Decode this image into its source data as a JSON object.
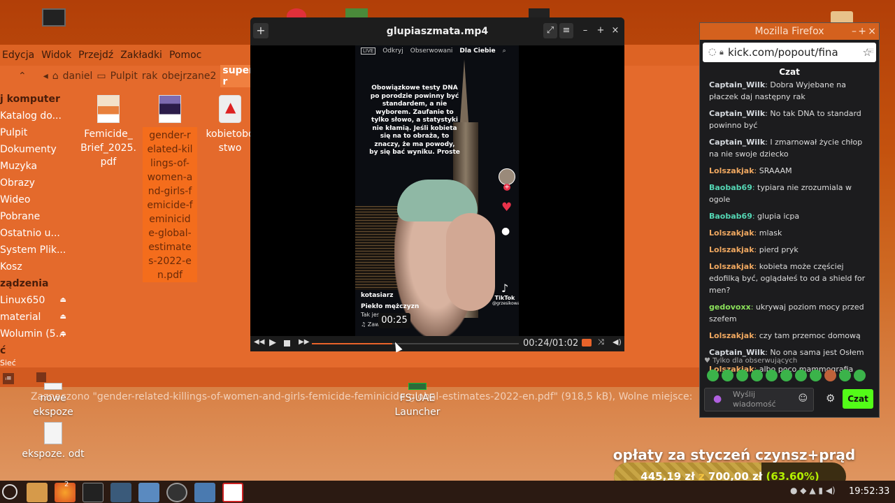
{
  "desktop": {
    "icons": [
      {
        "label": "nowe ekspoze"
      },
      {
        "label": "ekspoze. odt"
      },
      {
        "label": "FS-UAE Launcher"
      }
    ]
  },
  "file_manager": {
    "menu": [
      "Edycja",
      "Widok",
      "Przejdź",
      "Zakładki",
      "Pomoc"
    ],
    "path": [
      "daniel",
      "Pulpit",
      "rak",
      "obejrzane2",
      "super-r"
    ],
    "sidebar": [
      {
        "label": "j komputer",
        "header": true
      },
      {
        "label": "Katalog do..."
      },
      {
        "label": "Pulpit"
      },
      {
        "label": "Dokumenty"
      },
      {
        "label": "Muzyka"
      },
      {
        "label": "Obrazy"
      },
      {
        "label": "Wideo"
      },
      {
        "label": "Pobrane"
      },
      {
        "label": "Ostatnio u..."
      },
      {
        "label": "System Plik..."
      },
      {
        "label": "Kosz"
      },
      {
        "label": "ządzenia",
        "header": true
      },
      {
        "label": "Linux650",
        "eject": true
      },
      {
        "label": "material",
        "eject": true
      },
      {
        "label": "Wolumin (5...",
        "eject": true
      },
      {
        "label": "ć",
        "header": true
      },
      {
        "label": "Sieć"
      }
    ],
    "files": [
      {
        "name": "Femicide_ Brief_2025. pdf"
      },
      {
        "name": "gender-related-killings-of-women-and-girls-femicide-feminicide-global-estimates-2022-en.pdf"
      },
      {
        "name": "kobietobo stwo"
      }
    ],
    "status": "Zaznaczono \"gender-related-killings-of-women-and-girls-femicide-feminicide-global-estimates-2022-en.pdf\" (918,5 kB), Wolne miejsce:"
  },
  "player": {
    "title": "glupiaszmata.mp4",
    "elapsed": "00:24",
    "duration": "01:02",
    "hover_time": "00:25",
    "progress": 0.39,
    "video": {
      "tabs": [
        "Odkryj",
        "Obserwowani",
        "Dla Ciebie"
      ],
      "caption": "Obowiązkowe testy DNA po porodzie powinny być standardem, a nie wyborem. Zaufanie to tylko słowo, a statystyki nie kłamią. Jeśli kobieta się na to obraża, to znaczy, że ma powody, by się bać wyniku. Proste",
      "user": "kotasiarz",
      "desc1": "Piekło mężczyzn",
      "desc2": "Tak jes",
      "desc3": "♫ Zaw",
      "watermark": "TikTok",
      "handle": "@grzesikowaa"
    }
  },
  "firefox": {
    "title": "Mozilla Firefox",
    "url": "kick.com/popout/fina",
    "chat_header": "Czat",
    "messages": [
      {
        "user": "Captain_Wilk",
        "color": "#d7dbe0",
        "text": "Dobra Wyjebane na płaczek daj następny rak"
      },
      {
        "user": "Captain_Wilk",
        "color": "#d7dbe0",
        "text": "No tak DNA to standard powinno być"
      },
      {
        "user": "Captain_Wilk",
        "color": "#d7dbe0",
        "text": "I zmarnował życie chłop na nie swoje dziecko"
      },
      {
        "user": "Lolszakjak",
        "color": "#f0a860",
        "text": "SRAAAM"
      },
      {
        "user": "Baobab69",
        "color": "#54d6b4",
        "text": "typiara nie zrozumiala w ogole"
      },
      {
        "user": "Baobab69",
        "color": "#54d6b4",
        "text": "glupia icpa"
      },
      {
        "user": "Lolszakjak",
        "color": "#f0a860",
        "text": "mlask"
      },
      {
        "user": "Lolszakjak",
        "color": "#f0a860",
        "text": "pierd pryk"
      },
      {
        "user": "Lolszakjak",
        "color": "#f0a860",
        "text": "kobieta może częściej edofilką być, oglądałeś to od a shield for men?"
      },
      {
        "user": "gedovoxx",
        "color": "#8be05a",
        "text": "ukrywaj poziom mocy przed szefem"
      },
      {
        "user": "Lolszakjak",
        "color": "#f0a860",
        "text": "czy tam przemoc domową"
      },
      {
        "user": "Captain_Wilk",
        "color": "#d7dbe0",
        "text": "No ona sama jest Osłem"
      },
      {
        "user": "Lolszakjak",
        "color": "#f0a860",
        "text": "albo poco mammografia"
      }
    ],
    "followers_only": "Tylko dla obserwujących",
    "input_placeholder": "Wyślij wiadomość",
    "send_label": "Czat"
  },
  "overlay": {
    "title": "opłaty za styczeń czynsz+prąd",
    "current": "445,19 zł",
    "sep": "z",
    "goal": "700,00 zł",
    "percent": "(63.60%)",
    "progress": 0.636
  },
  "panel": {
    "clock": "19:52:33",
    "badge": "2"
  }
}
